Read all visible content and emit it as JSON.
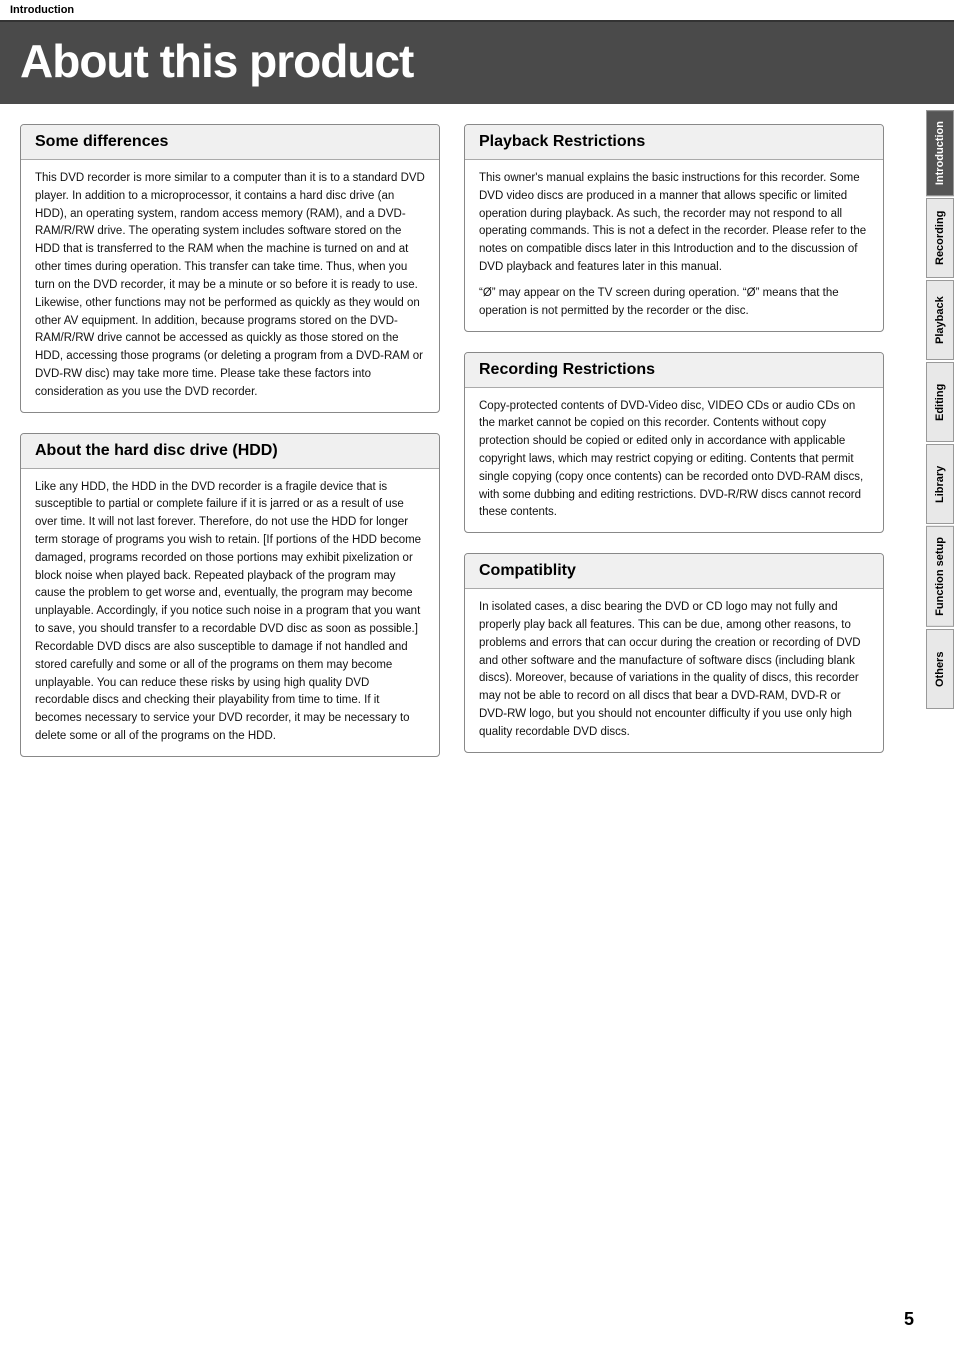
{
  "breadcrumb": "Introduction",
  "title": "About this product",
  "sidebar": {
    "tabs": [
      {
        "id": "introduction",
        "label": "Introduction",
        "active": true
      },
      {
        "id": "recording",
        "label": "Recording",
        "active": false
      },
      {
        "id": "playback",
        "label": "Playback",
        "active": false
      },
      {
        "id": "editing",
        "label": "Editing",
        "active": false
      },
      {
        "id": "library",
        "label": "Library",
        "active": false
      },
      {
        "id": "function-setup",
        "label": "Function setup",
        "active": false
      },
      {
        "id": "others",
        "label": "Others",
        "active": false
      }
    ]
  },
  "left": {
    "section1": {
      "title": "Some differences",
      "content": "This DVD recorder is more similar to a computer than it is to a standard DVD player.  In addition to a microprocessor, it contains a hard disc drive (an HDD), an operating system,  random access memory (RAM), and a DVD-RAM/R/RW drive.  The operating system includes software stored on the HDD that is transferred to the RAM when the machine is turned on and at other times during operation.  This transfer can take time.  Thus, when you turn on the DVD recorder, it may be a minute or so before it is ready to use.  Likewise, other functions may not be performed as quickly as they would on other AV equipment.  In addition, because programs stored on the DVD-RAM/R/RW drive cannot be accessed as quickly as those stored on the HDD, accessing those programs (or deleting a program from a DVD-RAM or DVD-RW disc) may take more time.  Please take these factors into consideration as you use the DVD recorder."
    },
    "section2": {
      "title": "About the hard disc drive (HDD)",
      "content": "Like any HDD, the HDD in the DVD recorder is a fragile device that is susceptible to partial or complete failure if it is jarred or as a result of use over time. It will not last forever. Therefore, do not use the HDD for longer term storage of programs you wish to retain.  [If portions of the HDD become damaged, programs recorded on those portions may exhibit pixelization or block noise when played back. Repeated playback of the program may cause the problem to get worse and, eventually, the program may become unplayable.  Accordingly, if you notice such noise in a program that you want to save, you should transfer to a recordable DVD disc as soon as possible.]  Recordable DVD discs are also susceptible to damage if not handled and stored carefully and some or all of the programs on them may become unplayable.  You can reduce these risks by using high quality DVD recordable discs and checking their playability from time to time.  If it becomes necessary to service your DVD recorder, it may be necessary to delete some or all of the programs on the HDD."
    }
  },
  "right": {
    "section1": {
      "title": "Playback Restrictions",
      "content1": "This owner's manual explains the basic instructions for this recorder. Some DVD video discs are produced in a manner that allows specific or limited operation during playback. As such, the recorder may not respond to all operating commands. This is not a defect in the recorder. Please refer to the notes on compatible discs later in this Introduction and to the discussion of DVD playback and features later in this manual.",
      "content2": "“Ø” may appear on the TV screen during operation. “Ø” means that the operation is not permitted by the recorder or the disc."
    },
    "section2": {
      "title": "Recording Restrictions",
      "content": "Copy-protected contents of DVD-Video disc, VIDEO CDs or audio CDs on the market cannot be copied on this recorder.\nContents without copy protection should be copied or edited only in accordance with applicable copyright laws, which may restrict copying or editing. Contents that permit single copying (copy once contents) can be recorded onto DVD-RAM discs, with some dubbing and editing restrictions. DVD-R/RW discs cannot record these contents."
    },
    "section3": {
      "title": "Compatiblity",
      "content": "In isolated cases, a disc bearing the DVD or CD logo may not fully and properly play back all features.  This can be due, among other reasons, to problems and errors that can occur during the creation or recording of DVD and other software and the manufacture of software discs (including blank discs).  Moreover, because of variations in the quality of discs, this recorder may not be able to record on all discs that bear a DVD-RAM, DVD-R or DVD-RW logo, but you should not encounter difficulty if you use only high quality recordable DVD discs."
    }
  },
  "page_number": "5"
}
